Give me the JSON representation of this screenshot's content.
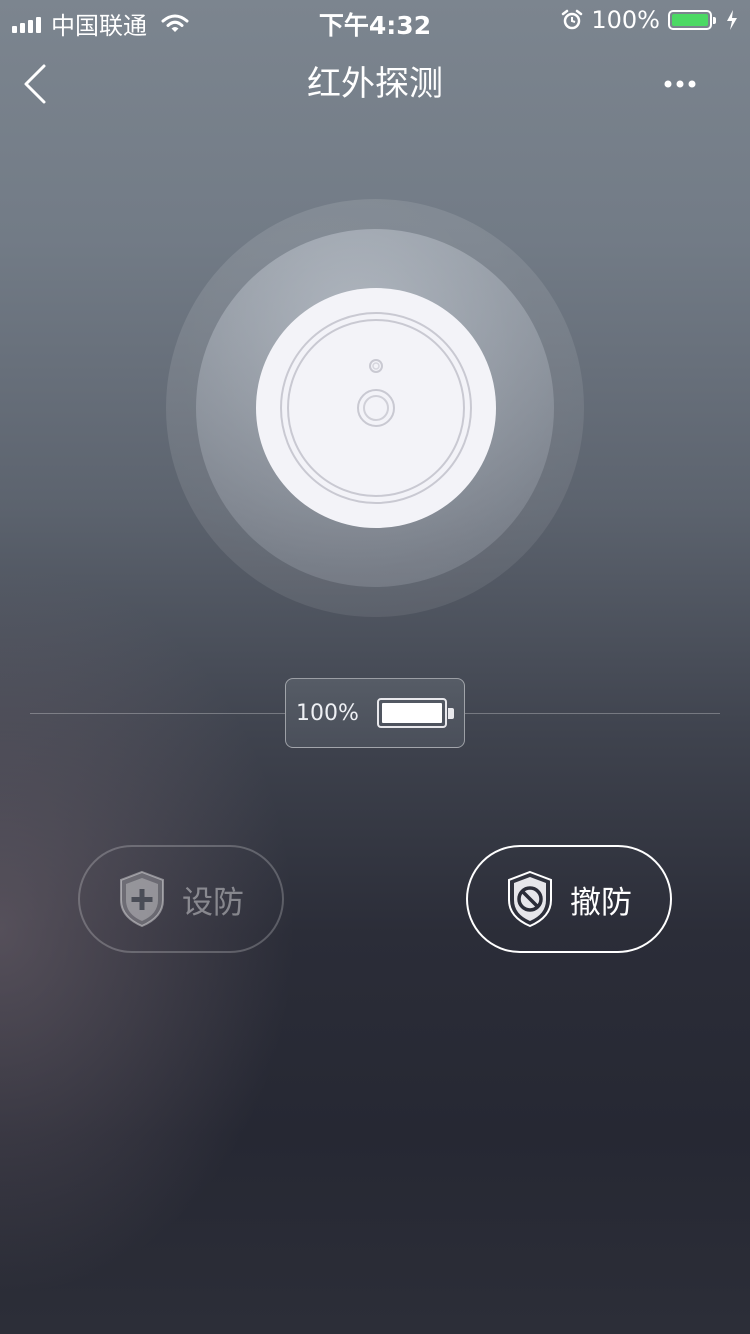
{
  "status_bar": {
    "carrier": "中国联通",
    "time": "下午4:32",
    "battery": "100%"
  },
  "nav": {
    "title": "红外探测"
  },
  "device": {
    "battery_label": "100%",
    "battery_level": 1.0
  },
  "actions": {
    "arm_label": "设防",
    "disarm_label": "撤防"
  },
  "colors": {
    "status_battery": "#4cd964",
    "device_face": "#f3f3f8"
  },
  "icons": [
    "signal-icon",
    "wifi-icon",
    "alarm-icon",
    "charging-icon",
    "back-icon",
    "more-icon",
    "shield-plus-icon",
    "shield-block-icon"
  ]
}
